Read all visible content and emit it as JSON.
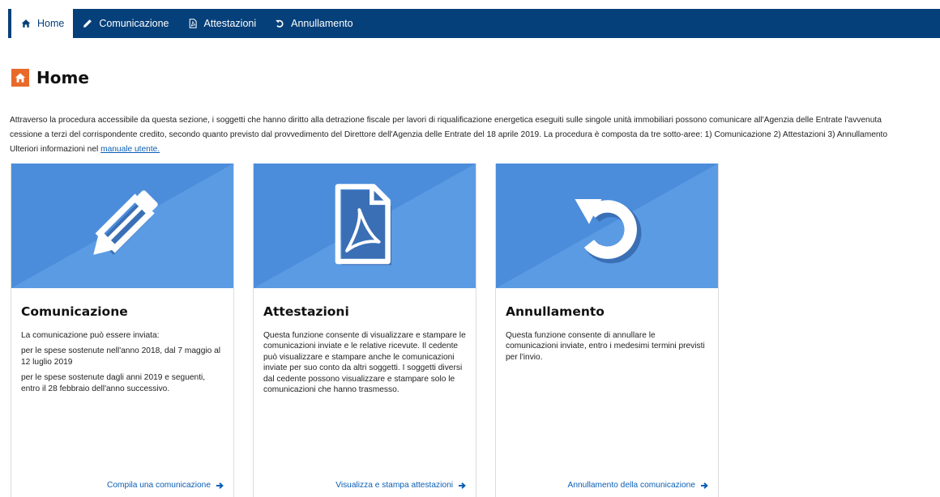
{
  "nav": {
    "items": [
      {
        "label": "Home",
        "icon": "home-icon",
        "active": true
      },
      {
        "label": "Comunicazione",
        "icon": "pencil-icon",
        "active": false
      },
      {
        "label": "Attestazioni",
        "icon": "pdf-file-icon",
        "active": false
      },
      {
        "label": "Annullamento",
        "icon": "undo-icon",
        "active": false
      }
    ]
  },
  "page": {
    "title": "Home",
    "intro_line1": "Attraverso la procedura accessibile da questa sezione, i soggetti che hanno diritto alla detrazione fiscale per lavori di riqualificazione energetica eseguiti sulle singole unità immobiliari possono comunicare all'Agenzia delle Entrate l'avvenuta",
    "intro_line2": "cessione a terzi del corrispondente credito, secondo quanto previsto dal provvedimento del Direttore dell'Agenzia delle Entrate del 18 aprile 2019. La procedura è composta da tre sotto-aree: 1) Comunicazione 2) Attestazioni 3) Annullamento",
    "more_info_prefix": "Ulteriori informazioni nel ",
    "more_info_link": "manuale utente."
  },
  "cards": [
    {
      "title": "Comunicazione",
      "icon": "pencil-icon",
      "paragraphs": [
        "La comunicazione può essere inviata:",
        "per le spese sostenute nell'anno 2018, dal 7 maggio al 12 luglio 2019",
        "per le spese sostenute dagli anni 2019 e seguenti, entro il 28 febbraio dell'anno successivo."
      ],
      "link": "Compila una comunicazione"
    },
    {
      "title": "Attestazioni",
      "icon": "pdf-file-icon",
      "paragraphs": [
        "Questa funzione consente di visualizzare e stampare le comunicazioni inviate e le relative ricevute. Il cedente può visualizzare e stampare anche le comunicazioni inviate per suo conto da altri soggetti. I soggetti diversi dal cedente possono visualizzare e stampare solo le comunicazioni che hanno trasmesso."
      ],
      "link": "Visualizza e stampa attestazioni"
    },
    {
      "title": "Annullamento",
      "icon": "undo-icon",
      "paragraphs": [
        "Questa funzione consente di annullare le comunicazioni inviate, entro i medesimi termini previsti per l'invio."
      ],
      "link": "Annullamento della comunicazione"
    }
  ],
  "colors": {
    "navbar": "#06407a",
    "title_icon": "#e8692a",
    "banner_dark": "#4c8ddb",
    "banner_light": "#5b9be4",
    "link": "#0a5fb4"
  }
}
